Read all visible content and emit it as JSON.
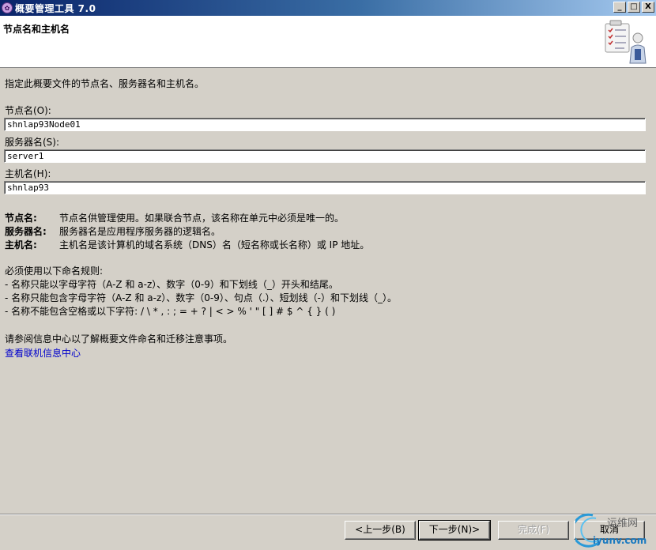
{
  "window": {
    "title": "概要管理工具 7.0",
    "app_icon": "app-logo-icon",
    "buttons": {
      "minimize": "_",
      "maximize": "□",
      "close": "X"
    }
  },
  "header": {
    "title": "节点名和主机名",
    "icon": "wizard-clipboard-person-icon"
  },
  "main": {
    "description": "指定此概要文件的节点名、服务器名和主机名。",
    "fields": [
      {
        "label": "节点名(O):",
        "value": "shnlap93Node01"
      },
      {
        "label": "服务器名(S):",
        "value": "server1"
      },
      {
        "label": "主机名(H):",
        "value": "shnlap93"
      }
    ],
    "definitions": [
      {
        "term": "节点名:",
        "text": "节点名供管理使用。如果联合节点，该名称在单元中必须是唯一的。"
      },
      {
        "term": "服务器名:",
        "text": "服务器名是应用程序服务器的逻辑名。"
      },
      {
        "term": "主机名:",
        "text": "主机名是该计算机的域名系统（DNS）名（短名称或长名称）或 IP 地址。"
      }
    ],
    "rules_title": "必须使用以下命名规则:",
    "rules": [
      "-  名称只能以字母字符（A-Z 和 a-z）、数字（0-9）和下划线（_）开头和结尾。",
      "-  名称只能包含字母字符（A-Z 和 a-z）、数字（0-9）、句点（.）、短划线（-）和下划线（_）。",
      "-  名称不能包含空格或以下字符: / \\ * , : ; = + ? | < >  % ' \" [ ] # $ ^ { } ( )"
    ],
    "info_text": "请参阅信息中心以了解概要文件命名和迁移注意事项。",
    "info_link": "查看联机信息中心"
  },
  "footer": {
    "back_label": "<上一步(B)",
    "next_label": "下一步(N)>",
    "finish_label": "完成(F)",
    "cancel_label": "取消"
  },
  "watermark": {
    "text_top": "运维网",
    "text_bottom": "iyunv.com"
  }
}
